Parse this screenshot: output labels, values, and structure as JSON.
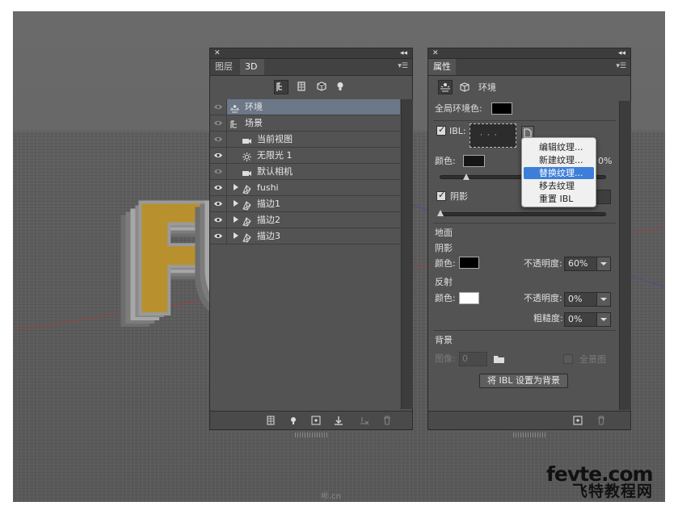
{
  "scene": {
    "letters": [
      "F",
      "U"
    ],
    "watermark_top": "fevte.com",
    "watermark_bottom": "飞特教程网",
    "faint_mark": "㉳.cn"
  },
  "panel3d": {
    "tabs": [
      "图层",
      "3D"
    ],
    "active_tab": "3D",
    "layers": [
      {
        "label": "环境",
        "icon": "environment-icon",
        "indent": 0,
        "expand": false,
        "selected": true,
        "eye": false
      },
      {
        "label": "场景",
        "icon": "scene-icon",
        "indent": 0,
        "expand": false,
        "selected": false,
        "eye": false
      },
      {
        "label": "当前视图",
        "icon": "camera-icon",
        "indent": 1,
        "expand": false,
        "selected": false,
        "eye": false
      },
      {
        "label": "无限光 1",
        "icon": "light-icon",
        "indent": 1,
        "expand": false,
        "selected": false,
        "eye": true
      },
      {
        "label": "默认相机",
        "icon": "camera-icon",
        "indent": 1,
        "expand": false,
        "selected": false,
        "eye": false
      },
      {
        "label": "fushi",
        "icon": "mesh-icon",
        "indent": 1,
        "expand": true,
        "selected": false,
        "eye": true
      },
      {
        "label": "描边1",
        "icon": "mesh-icon",
        "indent": 1,
        "expand": true,
        "selected": false,
        "eye": true
      },
      {
        "label": "描边2",
        "icon": "mesh-icon",
        "indent": 1,
        "expand": true,
        "selected": false,
        "eye": true
      },
      {
        "label": "描边3",
        "icon": "mesh-icon",
        "indent": 1,
        "expand": true,
        "selected": false,
        "eye": true
      }
    ]
  },
  "props": {
    "tab": "属性",
    "header": "环境",
    "global_ambient_label": "全局环境色:",
    "global_ambient_color": "#000000",
    "ibl_label": "IBL:",
    "color_label": "颜色:",
    "light_color": "#161616",
    "intensity_partial": "0%",
    "shadow_label": "阴影",
    "ground_label": "地面",
    "ground_shadow_label": "阴影",
    "ground_shadow_color_label": "颜色:",
    "ground_shadow_color": "#000000",
    "opacity_label": "不透明度:",
    "ground_shadow_opacity": "60%",
    "reflection_label": "反射",
    "reflection_color_label": "颜色:",
    "reflection_color": "#ffffff",
    "reflection_opacity_label": "不透明度:",
    "reflection_opacity": "0%",
    "roughness_label": "粗糙度:",
    "roughness": "0%",
    "background_label": "背景",
    "image_label": "图像:",
    "image_value": "0",
    "panorama_label": "全景图",
    "set_bg_button": "将 IBL 设置为背景"
  },
  "context_menu": {
    "items": [
      "编辑纹理...",
      "新建纹理...",
      "替换纹理...",
      "移去纹理",
      "重置 IBL"
    ],
    "highlighted": "替换纹理..."
  }
}
